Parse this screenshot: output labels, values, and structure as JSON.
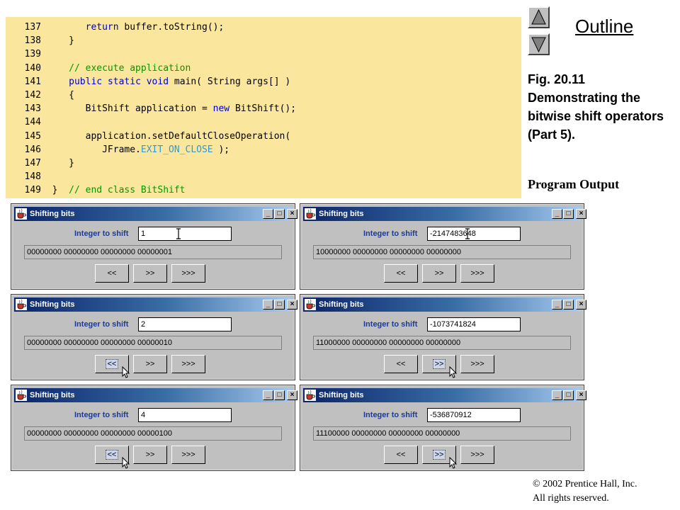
{
  "code_lines": [
    {
      "num": "137",
      "parts": [
        {
          "t": "      "
        },
        {
          "t": "return",
          "c": "kw"
        },
        {
          "t": " buffer.toString();"
        }
      ]
    },
    {
      "num": "138",
      "parts": [
        {
          "t": "   }"
        }
      ]
    },
    {
      "num": "139",
      "parts": [
        {
          "t": ""
        }
      ]
    },
    {
      "num": "140",
      "parts": [
        {
          "t": "   "
        },
        {
          "t": "// execute application",
          "c": "cm"
        }
      ]
    },
    {
      "num": "141",
      "parts": [
        {
          "t": "   "
        },
        {
          "t": "public",
          "c": "kw"
        },
        {
          "t": " "
        },
        {
          "t": "static",
          "c": "kw"
        },
        {
          "t": " "
        },
        {
          "t": "void",
          "c": "kw"
        },
        {
          "t": " main( String args[] )"
        }
      ]
    },
    {
      "num": "142",
      "parts": [
        {
          "t": "   {"
        }
      ]
    },
    {
      "num": "143",
      "parts": [
        {
          "t": "      BitShift application = "
        },
        {
          "t": "new",
          "c": "kw"
        },
        {
          "t": " BitShift();"
        }
      ]
    },
    {
      "num": "144",
      "parts": [
        {
          "t": ""
        }
      ]
    },
    {
      "num": "145",
      "parts": [
        {
          "t": "      application.setDefaultCloseOperation("
        }
      ]
    },
    {
      "num": "146",
      "parts": [
        {
          "t": "         JFrame."
        },
        {
          "t": "EXIT_ON_CLOSE",
          "c": "cst"
        },
        {
          "t": " );"
        }
      ]
    },
    {
      "num": "147",
      "parts": [
        {
          "t": "   }"
        }
      ]
    },
    {
      "num": "148",
      "parts": [
        {
          "t": ""
        }
      ]
    },
    {
      "num": "149",
      "parts": [
        {
          "t": "}  "
        },
        {
          "t": "// end class BitShift",
          "c": "cm"
        }
      ]
    }
  ],
  "sidebar": {
    "outline_label": "Outline",
    "up_icon": "triangle-up-icon",
    "down_icon": "triangle-down-icon",
    "fig_caption": "Fig. 20.11 Demonstrating the bitwise shift operators (Part 5).",
    "program_output": "Program Output",
    "copyright_line1": "© 2002 Prentice Hall, Inc.",
    "copyright_line2": "All rights reserved."
  },
  "app": {
    "title": "Shifting bits",
    "integer_label": "Integer to shift",
    "btn_left": "<<",
    "btn_right_signed": ">>",
    "btn_right_unsigned": ">>>",
    "title_buttons": [
      "_",
      "□",
      "×"
    ]
  },
  "windows": [
    {
      "value": "1",
      "bits": "00000000 00000000 00000000 00000001",
      "pressed": null,
      "ibeam": true
    },
    {
      "value": "-2147483648",
      "bits": "10000000 00000000 00000000 00000000",
      "pressed": null,
      "ibeam": true
    },
    {
      "value": "2",
      "bits": "00000000 00000000 00000000 00000010",
      "pressed": "left",
      "ibeam": false
    },
    {
      "value": "-1073741824",
      "bits": "11000000 00000000 00000000 00000000",
      "pressed": "right",
      "ibeam": false
    },
    {
      "value": "4",
      "bits": "00000000 00000000 00000000 00000100",
      "pressed": "left",
      "ibeam": false
    },
    {
      "value": "-536870912",
      "bits": "11100000 00000000 00000000 00000000",
      "pressed": "right",
      "ibeam": false
    }
  ]
}
